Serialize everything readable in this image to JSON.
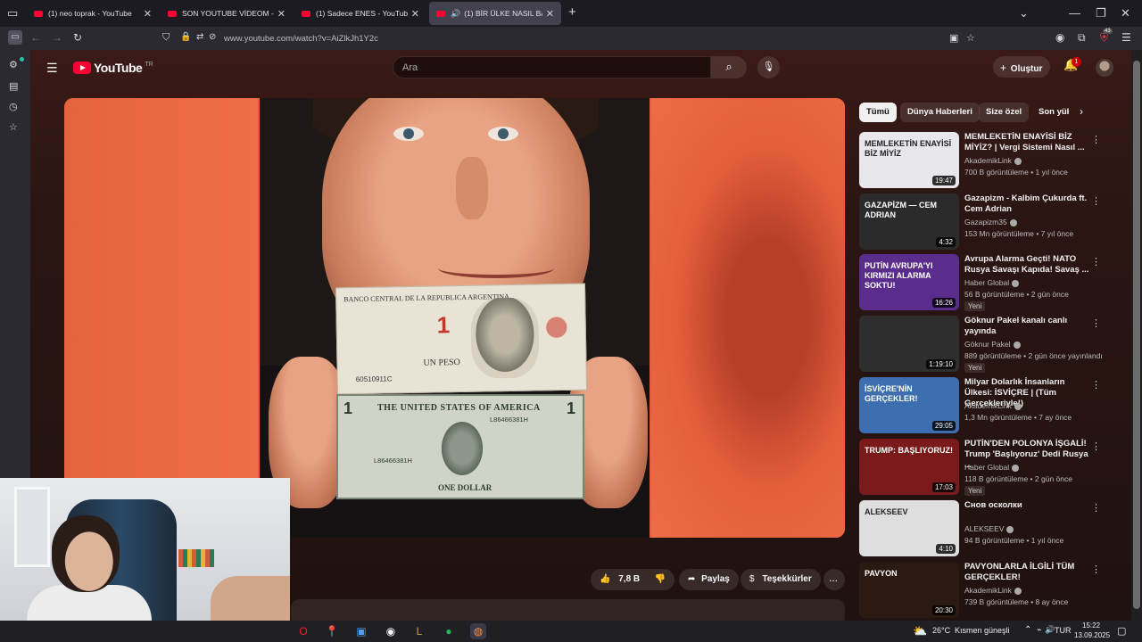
{
  "browser": {
    "tabs": [
      {
        "title": "(1) neo toprak - YouTube",
        "active": false
      },
      {
        "title": "SON YOUTUBE VİDEOM - YouTube",
        "active": false
      },
      {
        "title": "(1) Sadece ENES - YouTube",
        "active": false
      },
      {
        "title": "(1) BİR ÜLKE NASIL BATAR?",
        "active": true
      }
    ],
    "new_tab": "+",
    "url": "www.youtube.com/watch?v=AiZlkJh1Y2c",
    "extension_badge": "43"
  },
  "youtube": {
    "logo_text": "YouTube",
    "country_code": "TR",
    "search_placeholder": "Ara",
    "create_label": "Oluştur",
    "notification_count": "1",
    "actions": {
      "likes": "7,8 B",
      "share": "Paylaş",
      "thanks": "Teşekkürler",
      "more": "..."
    },
    "chips": [
      {
        "label": "Tümü",
        "selected": true
      },
      {
        "label": "Dünya Haberleri",
        "selected": false
      },
      {
        "label": "Size özel",
        "selected": false
      },
      {
        "label": "Son yük",
        "selected": false
      }
    ],
    "recommendations": [
      {
        "title": "MEMLEKETİN ENAYİSİ BİZ MİYİZ? | Vergi Sistemi Nasıl ...",
        "channel": "AkademikLink",
        "meta": "700 B görüntüleme • 1 yıl önce",
        "duration": "19:47",
        "badge": "",
        "thumb_text": "MEMLEKETİN ENAYİSİ BİZ MİYİZ",
        "thumb_bg": "#e7e7ec"
      },
      {
        "title": "Gazapizm - Kalbim Çukurda ft. Cem Adrian",
        "channel": "Gazapizm35",
        "meta": "153 Mn görüntüleme • 7 yıl önce",
        "duration": "4:32",
        "badge": "",
        "thumb_text": "GAZAPİZM — CEM ADRIAN",
        "thumb_bg": "#2b2b2b"
      },
      {
        "title": "Avrupa Alarma Geçti! NATO Rusya Savaşı Kapıda! Savaş ...",
        "channel": "Haber Global",
        "meta": "56 B görüntüleme • 2 gün önce",
        "duration": "16:26",
        "badge": "Yeni",
        "thumb_text": "PUTİN AVRUPA'YI KIRMIZI ALARMA SOKTU!",
        "thumb_bg": "#5a2d8c"
      },
      {
        "title": "Göknur Pakel kanalı canlı yayında",
        "channel": "Göknur Pakel",
        "meta": "889 görüntüleme • 2 gün önce yayınlandı",
        "duration": "1:19:10",
        "badge": "Yeni",
        "thumb_text": "",
        "thumb_bg": "#2e2e2e"
      },
      {
        "title": "Milyar Dolarlık İnsanların Ülkesi: İSVİÇRE | (Tüm Gerçekleriyle!)",
        "channel": "AkademikLink",
        "meta": "1,3 Mn görüntüleme • 7 ay önce",
        "duration": "29:05",
        "badge": "",
        "thumb_text": "İSVİÇRE'NİN GERÇEKLER!",
        "thumb_bg": "#3d6fb0"
      },
      {
        "title": "PUTİN'DEN POLONYA İŞGALİ! Trump 'Başlıyoruz' Dedi Rusya ...",
        "channel": "Haber Global",
        "meta": "118 B görüntüleme • 2 gün önce",
        "duration": "17:03",
        "badge": "Yeni",
        "thumb_text": "TRUMP: BAŞLIYORUZ!",
        "thumb_bg": "#7a1a1a"
      },
      {
        "title": "Снов осколки",
        "channel": "ALEKSEEV",
        "meta": "94 B görüntüleme • 1 yıl önce",
        "duration": "4:10",
        "badge": "",
        "thumb_text": "ALEKSEEV",
        "thumb_bg": "#dedede"
      },
      {
        "title": "PAVYONLARLA İLGİLİ TÜM GERÇEKLER!",
        "channel": "AkademikLink",
        "meta": "739 B görüntüleme • 8 ay önce",
        "duration": "20:30",
        "badge": "",
        "thumb_text": "PAVYON",
        "thumb_bg": "#2a1a12"
      }
    ]
  },
  "video_frame": {
    "peso_bank": "BANCO CENTRAL DE LA REPUBLICA ARGENTINA",
    "peso_value": "1",
    "peso_word": "UN PESO",
    "peso_serial": "60510911C",
    "dollar_header": "THE UNITED STATES OF AMERICA",
    "dollar_serial": "L86466381H",
    "dollar_bottom": "ONE DOLLAR"
  },
  "taskbar": {
    "weather": "26°C",
    "weather_desc": "Kısmen güneşli",
    "language": "TUR",
    "time": "15:22",
    "date": "13.09.2025"
  },
  "colors": {
    "youtube_red": "#ff0033",
    "browser_bg": "#1c1b22",
    "toolbar_bg": "#2b2a33",
    "page_bg": "#2a1512"
  }
}
